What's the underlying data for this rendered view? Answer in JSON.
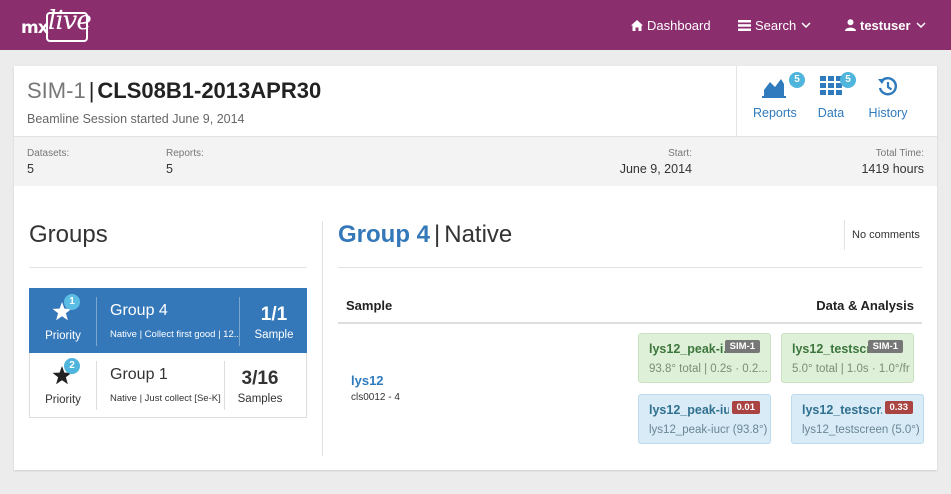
{
  "brand": {
    "logo_prefix": "mx",
    "logo_word": "live",
    "bar_color": "#8b2e6d"
  },
  "nav": {
    "dashboard": "Dashboard",
    "search": "Search",
    "user": "testuser"
  },
  "session": {
    "prefix": "SIM-1",
    "separator": "|",
    "name": "CLS08B1-2013APR30",
    "subtitle": "Beamline Session started June 9, 2014"
  },
  "actions": {
    "reports": {
      "label": "Reports",
      "badge": "5"
    },
    "data": {
      "label": "Data",
      "badge": "5"
    },
    "history": {
      "label": "History"
    }
  },
  "stats": {
    "datasets": {
      "label": "Datasets:",
      "value": "5"
    },
    "reports": {
      "label": "Reports:",
      "value": "5"
    },
    "start": {
      "label": "Start:",
      "value": "June 9, 2014"
    },
    "total_time": {
      "label": "Total Time:",
      "value": "1419 hours"
    }
  },
  "groups": {
    "title": "Groups",
    "items": [
      {
        "priority": "1",
        "priority_label": "Priority",
        "name": "Group 4",
        "desc": "Native | Collect first good | 12...",
        "count": "1/1",
        "count_label": "Sample",
        "active": true
      },
      {
        "priority": "2",
        "priority_label": "Priority",
        "name": "Group 1",
        "desc": "Native | Just collect [Se-K]",
        "count": "3/16",
        "count_label": "Samples",
        "active": false
      }
    ]
  },
  "group_detail": {
    "group": "Group 4",
    "separator": "|",
    "kind": "Native",
    "comments": "No comments",
    "table_headers": {
      "sample": "Sample",
      "data": "Data & Analysis"
    },
    "sample": {
      "name": "lys12",
      "sub": "cls0012 - 4"
    },
    "tiles": [
      {
        "name": "lys12_peak-i...",
        "tag": "SIM-1",
        "desc": "93.8° total | 0.2s · 0.2...",
        "style": "green"
      },
      {
        "name": "lys12_testscre...",
        "tag": "SIM-1",
        "desc": "5.0° total | 1.0s · 1.0°/fr...",
        "style": "green"
      },
      {
        "name": "lys12_peak-iu...",
        "tag": "0.01",
        "desc": "lys12_peak-iucr (93.8°)",
        "style": "blue"
      },
      {
        "name": "lys12_testscr...",
        "tag": "0.33",
        "desc": "lys12_testscreen (5.0°)",
        "style": "blue"
      }
    ]
  },
  "colors": {
    "accent": "#3478b9",
    "link": "#2f7bbd",
    "badge": "#4fb5dc"
  }
}
